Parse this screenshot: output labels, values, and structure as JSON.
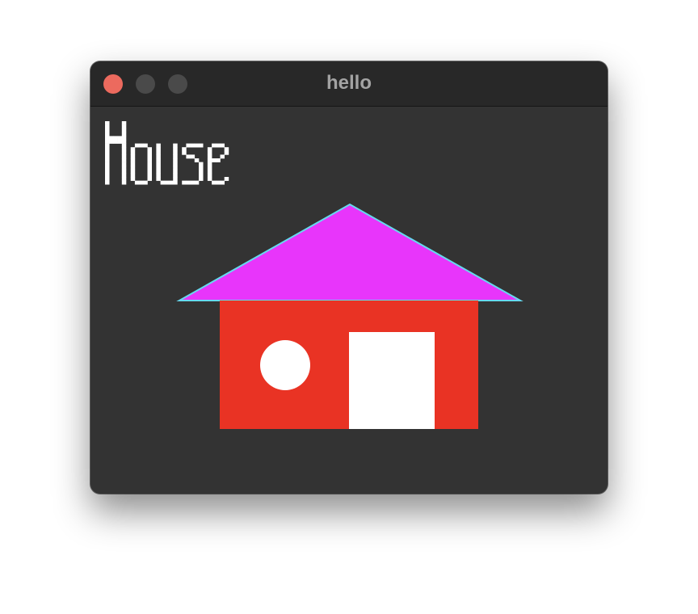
{
  "window": {
    "title": "hello",
    "background_color": "#333333",
    "titlebar_color": "#282828",
    "traffic_lights": {
      "close": {
        "name": "close-window",
        "color": "#ec6a5e"
      },
      "minimize": {
        "name": "minimize-window",
        "color": "#4a4a4a"
      },
      "zoom": {
        "name": "zoom-window",
        "color": "#4a4a4a"
      }
    }
  },
  "canvas": {
    "heading": "House",
    "heading_color": "#ffffff",
    "house": {
      "roof_color": "#e835fb",
      "roof_outline_color": "#66d9ef",
      "wall_color": "#e93324",
      "window_color": "#ffffff",
      "door_color": "#ffffff",
      "roof_icon": "roof-triangle",
      "window_icon": "round-window",
      "door_icon": "door-rectangle"
    }
  }
}
